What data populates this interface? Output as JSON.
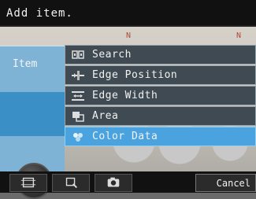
{
  "title": "Add item.",
  "left_panel": {
    "item_label": "Item"
  },
  "menu": {
    "items": [
      {
        "label": "Search",
        "icon": "search-icon",
        "selected": false
      },
      {
        "label": "Edge Position",
        "icon": "edge-position-icon",
        "selected": false
      },
      {
        "label": "Edge Width",
        "icon": "edge-width-icon",
        "selected": false
      },
      {
        "label": "Area",
        "icon": "area-icon",
        "selected": false
      },
      {
        "label": "Color Data",
        "icon": "color-data-icon",
        "selected": true
      }
    ]
  },
  "toolbar": {
    "buttons": [
      "frame-icon",
      "zoom-icon",
      "camera-icon"
    ],
    "cancel_label": "Cancel"
  },
  "colors": {
    "menu_bg": "#3f4a52",
    "selected_bg": "#4aa3de",
    "left_panel_bg": "#7fb3d6",
    "item_tab_bg": "#3a8fc6"
  }
}
